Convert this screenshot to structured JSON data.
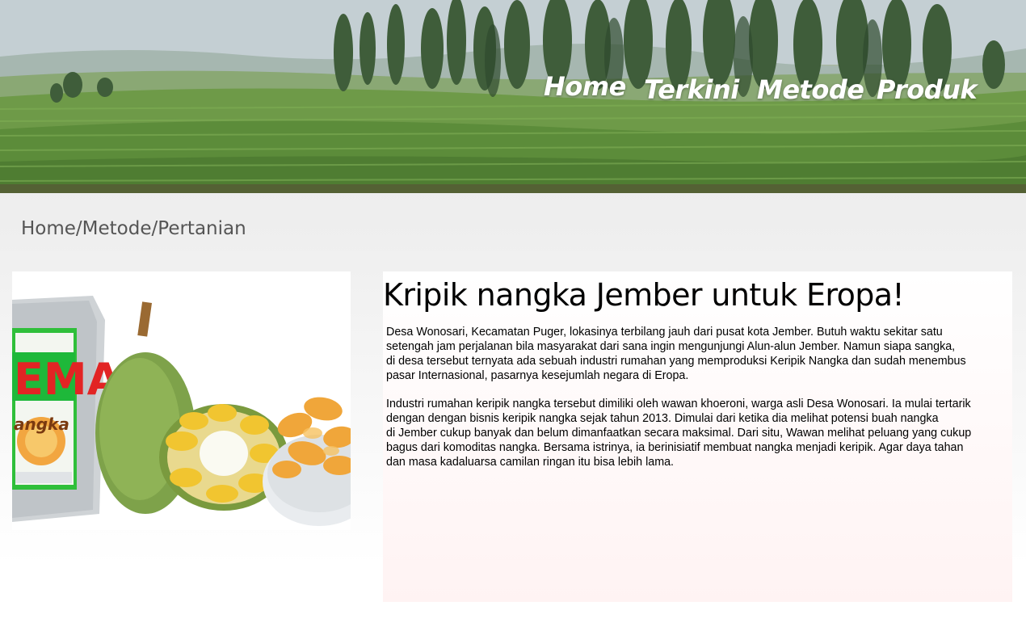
{
  "header": {
    "nav": [
      {
        "label": "Home"
      },
      {
        "label": "Terkini"
      },
      {
        "label": "Metode"
      },
      {
        "label": "Produk"
      }
    ]
  },
  "breadcrumb": {
    "items": [
      "Home",
      "Metode",
      "Pertanian"
    ],
    "separator": "/"
  },
  "product": {
    "image_alt": "keripik nangka",
    "package_text": "EMA",
    "package_subtext": "angka"
  },
  "article": {
    "title": "Kripik nangka Jember untuk Eropa!",
    "paragraphs": [
      "Desa Wonosari, Kecamatan Puger, lokasinya terbilang jauh dari pusat kota Jember. Butuh waktu sekitar satu\n setengah jam perjalanan bila masyarakat dari sana ingin mengunjungi Alun-alun Jember. Namun siapa sangka,\n di desa tersebut ternyata ada sebuah industri rumahan yang memproduksi Keripik Nangka dan sudah menembus\n pasar Internasional, pasarnya kesejumlah negara di Eropa.",
      "Industri rumahan keripik nangka tersebut dimiliki oleh wawan khoeroni, warga asli Desa Wonosari. Ia mulai tertarik\ndengan dengan bisnis keripik nangka sejak tahun 2013. Dimulai dari ketika dia melihat potensi buah nangka\n di Jember cukup banyak dan belum dimanfaatkan secara maksimal. Dari situ, Wawan melihat peluang yang cukup\n bagus dari komoditas nangka. Bersama istrinya, ia berinisiatif membuat nangka menjadi keripik. Agar daya tahan\ndan masa kadaluarsa camilan ringan itu bisa lebih lama."
    ]
  },
  "colors": {
    "nav_text": "#ffffff",
    "breadcrumb_text": "#555555",
    "title_text": "#000000"
  }
}
